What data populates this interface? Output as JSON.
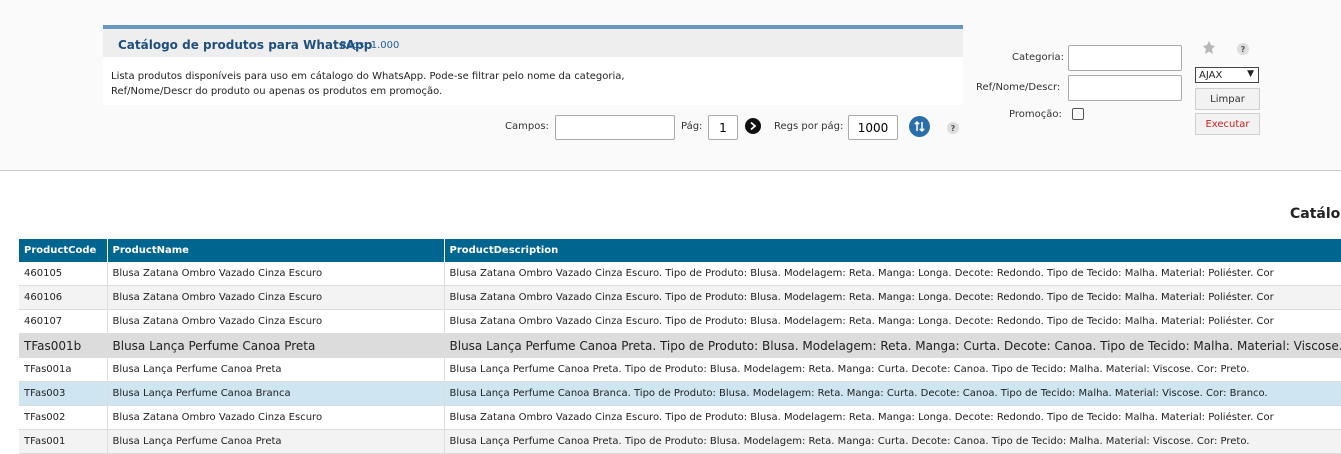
{
  "info": {
    "title": "Catálogo de produtos para WhatsApp",
    "regs": "Regs: 1.000",
    "description": "Lista produtos disponíveis para uso em cátalogo do WhatsApp. Pode-se filtrar pelo nome da categoria, Ref/Nome/Descr do produto ou apenas os produtos em promoção."
  },
  "pager": {
    "campos_label": "Campos:",
    "campos_value": "",
    "pag_label": "Pág:",
    "pag_value": "1",
    "regs_por_pag_label": "Regs por pág:",
    "regs_por_pag_value": "1000",
    "help": "?"
  },
  "filters": {
    "categoria_label": "Categoria:",
    "categoria_value": "",
    "ref_label": "Ref/Nome/Descr:",
    "ref_value": "",
    "promocao_label": "Promoção:",
    "promocao_checked": false,
    "help": "?",
    "mode_select": "AJAX",
    "limpar": "Limpar",
    "executar": "Executar"
  },
  "page_title": "Catálog",
  "colors": {
    "header": "#00668f",
    "accent": "#2a6fa8",
    "danger": "#cc2222"
  },
  "table": {
    "columns": [
      "ProductCode",
      "ProductName",
      "ProductDescription"
    ],
    "rows": [
      [
        "460105",
        "Blusa Zatana Ombro Vazado Cinza Escuro",
        "Blusa Zatana Ombro Vazado Cinza Escuro. Tipo de Produto: Blusa. Modelagem: Reta. Manga: Longa. Decote: Redondo. Tipo de Tecido: Malha. Material: Poliéster. Cor"
      ],
      [
        "460106",
        "Blusa Zatana Ombro Vazado Cinza Escuro",
        "Blusa Zatana Ombro Vazado Cinza Escuro. Tipo de Produto: Blusa. Modelagem: Reta. Manga: Longa. Decote: Redondo. Tipo de Tecido: Malha. Material: Poliéster. Cor"
      ],
      [
        "460107",
        "Blusa Zatana Ombro Vazado Cinza Escuro",
        "Blusa Zatana Ombro Vazado Cinza Escuro. Tipo de Produto: Blusa. Modelagem: Reta. Manga: Longa. Decote: Redondo. Tipo de Tecido: Malha. Material: Poliéster. Cor"
      ],
      [
        "TFas001b",
        "Blusa Lança Perfume Canoa Preta",
        "Blusa Lança Perfume Canoa Preta. Tipo de Produto: Blusa. Modelagem: Reta. Manga: Curta. Decote: Canoa. Tipo de Tecido: Malha. Material: Viscose."
      ],
      [
        "TFas001a",
        "Blusa Lança Perfume Canoa Preta",
        "Blusa Lança Perfume Canoa Preta. Tipo de Produto: Blusa. Modelagem: Reta. Manga: Curta. Decote: Canoa. Tipo de Tecido: Malha. Material: Viscose. Cor: Preto."
      ],
      [
        "TFas003",
        "Blusa Lança Perfume Canoa Branca",
        "Blusa Lança Perfume Canoa Branca. Tipo de Produto: Blusa. Modelagem: Reta. Manga: Curta. Decote: Canoa. Tipo de Tecido: Malha. Material: Viscose. Cor: Branco."
      ],
      [
        "TFas002",
        "Blusa Zatana Ombro Vazado Cinza Escuro",
        "Blusa Zatana Ombro Vazado Cinza Escuro. Tipo de Produto: Blusa. Modelagem: Reta. Manga: Longa. Decote: Redondo. Tipo de Tecido: Malha. Material: Poliéster. Cor"
      ],
      [
        "TFas001",
        "Blusa Lança Perfume Canoa Preta",
        "Blusa Lança Perfume Canoa Preta. Tipo de Produto: Blusa. Modelagem: Reta. Manga: Curta. Decote: Canoa. Tipo de Tecido: Malha. Material: Viscose. Cor: Preto."
      ]
    ]
  }
}
